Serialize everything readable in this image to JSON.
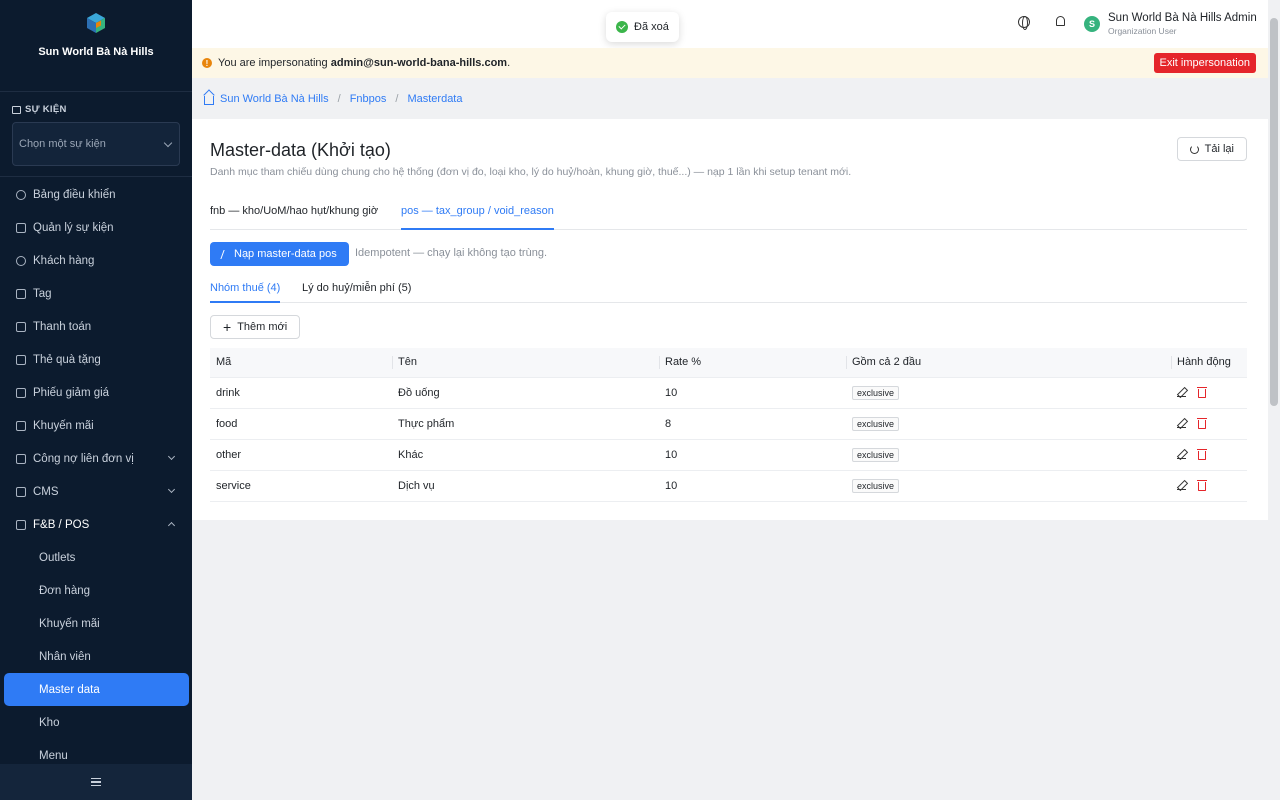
{
  "sidebar": {
    "brand_name": "Sun World Bà Nà Hills",
    "brand_sub": "",
    "section_label": "SỰ KIỆN",
    "event_placeholder": "Chọn một sự kiện",
    "nav": [
      {
        "label": "Bảng điều khiển",
        "icon": "gauge-icon"
      },
      {
        "label": "Quản lý sự kiện",
        "icon": "calendar-icon"
      },
      {
        "label": "Khách hàng",
        "icon": "users-icon"
      },
      {
        "label": "Tag",
        "icon": "tag-icon"
      },
      {
        "label": "Thanh toán",
        "icon": "payment-icon"
      },
      {
        "label": "Thẻ quà tặng",
        "icon": "gift-icon"
      },
      {
        "label": "Phiếu giảm giá",
        "icon": "coupon-icon"
      },
      {
        "label": "Khuyến mãi",
        "icon": "bolt-icon"
      },
      {
        "label": "Công nợ liên đơn vị",
        "icon": "debt-icon"
      },
      {
        "label": "CMS",
        "icon": "cms-icon"
      },
      {
        "label": "F&B / POS",
        "icon": "coffee-icon"
      }
    ],
    "sub_items": [
      "Outlets",
      "Đơn hàng",
      "Khuyến mãi",
      "Nhân viên",
      "Master data",
      "Kho",
      "Menu"
    ]
  },
  "topbar": {
    "toast": "Đã xoá",
    "user_initial": "S",
    "user_name": "Sun World Bà Nà Hills Admin",
    "user_role": "Organization User"
  },
  "impersonation": {
    "prefix": "You are impersonating",
    "email": "admin@sun-world-bana-hills.com",
    "suffix": ".",
    "exit_label": "Exit impersonation"
  },
  "breadcrumb": [
    "Sun World Bà Nà Hills",
    "Fnbpos",
    "Masterdata"
  ],
  "page": {
    "title": "Master-data (Khởi tạo)",
    "description": "Danh mục tham chiếu dùng chung cho hệ thống (đơn vị đo, loại kho, lý do huỷ/hoàn, khung giờ, thuế...) — nạp 1 lần khi setup tenant mới.",
    "reload_label": "Tải lại",
    "tabs": [
      "fnb — kho/UoM/hao hụt/khung giờ",
      "pos — tax_group / void_reason"
    ],
    "seed_label": "Nạp master-data pos",
    "seed_note": "Idempotent — chạy lại không tạo trùng.",
    "subtabs": [
      "Nhóm thuế (4)",
      "Lý do huỷ/miễn phí (5)"
    ],
    "add_label": "Thêm mới"
  },
  "table": {
    "headers": [
      "Mã",
      "Tên",
      "Rate %",
      "Gồm cả 2 đầu",
      "Hành động"
    ],
    "rows": [
      {
        "code": "drink",
        "name": "Đồ uống",
        "rate": "10",
        "inclusive": "exclusive"
      },
      {
        "code": "food",
        "name": "Thực phẩm",
        "rate": "8",
        "inclusive": "exclusive"
      },
      {
        "code": "other",
        "name": "Khác",
        "rate": "10",
        "inclusive": "exclusive"
      },
      {
        "code": "service",
        "name": "Dịch vụ",
        "rate": "10",
        "inclusive": "exclusive"
      }
    ]
  },
  "colors": {
    "sidebar_bg": "#0c1b2e",
    "accent": "#2f7bf5",
    "danger": "#e5252a",
    "success": "#3bb54a",
    "warn": "#e8850c"
  }
}
